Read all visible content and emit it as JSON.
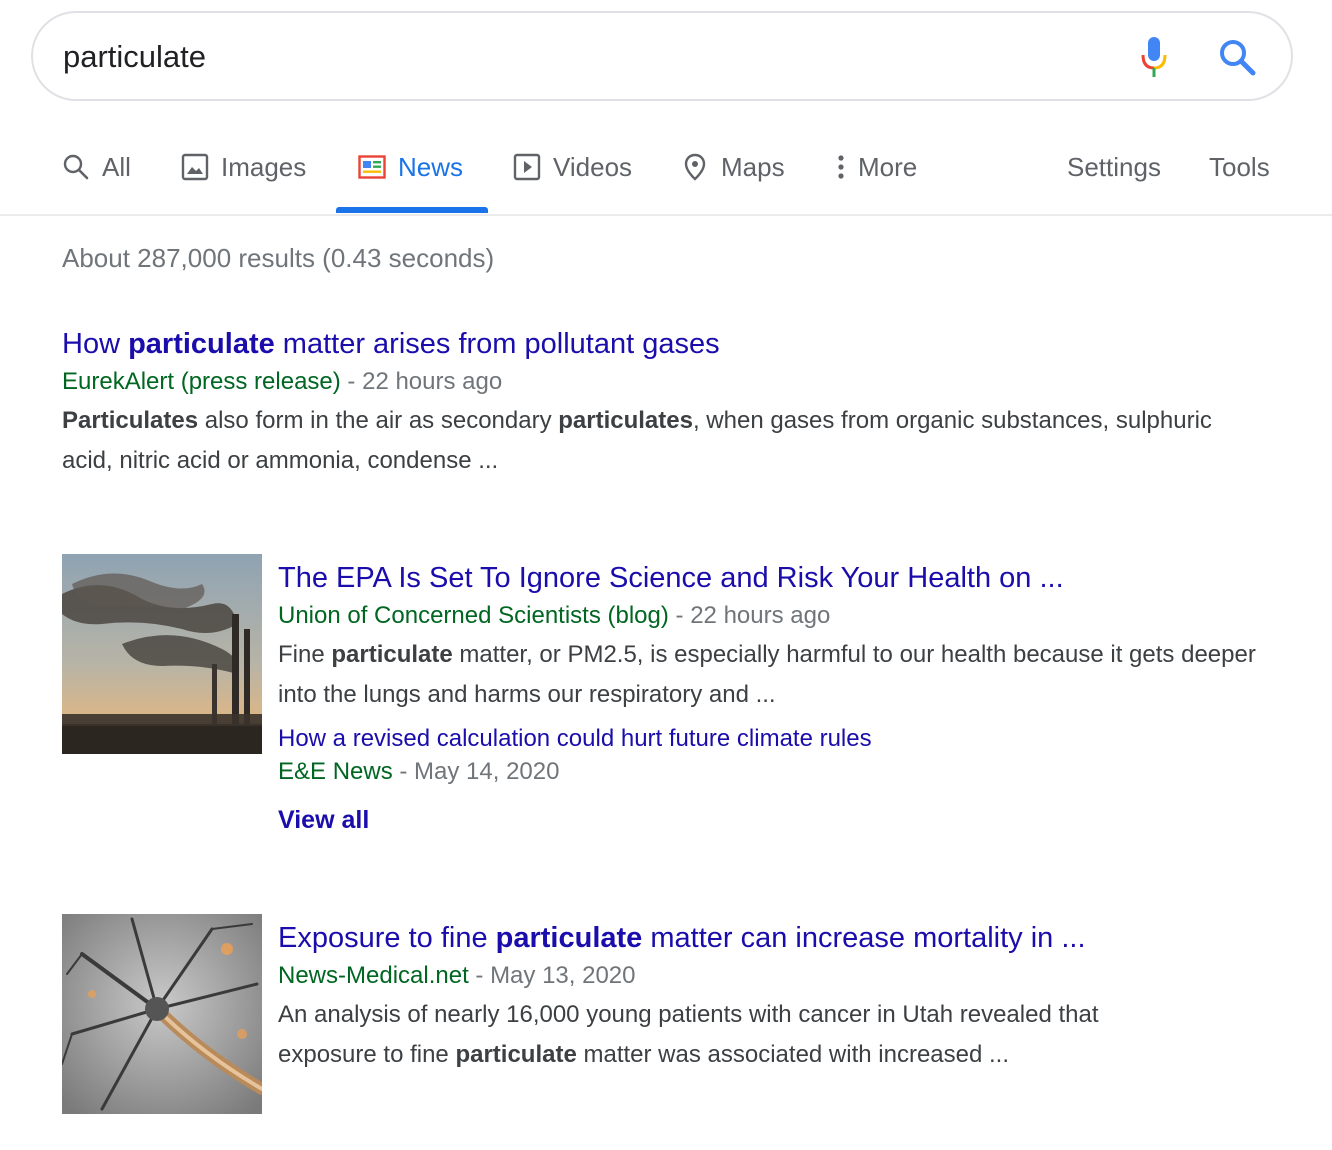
{
  "search": {
    "query": "particulate"
  },
  "tabs": [
    {
      "label": "All",
      "icon": "search-icon"
    },
    {
      "label": "Images",
      "icon": "image-icon"
    },
    {
      "label": "News",
      "icon": "news-icon",
      "active": true
    },
    {
      "label": "Videos",
      "icon": "play-icon"
    },
    {
      "label": "Maps",
      "icon": "map-pin-icon"
    },
    {
      "label": "More",
      "icon": "more-vertical-icon"
    },
    {
      "label": "Settings"
    },
    {
      "label": "Tools"
    }
  ],
  "stats": "About 287,000 results (0.43 seconds)",
  "results": [
    {
      "title_pre": "How ",
      "title_bold": "particulate",
      "title_post": " matter arises from pollutant gases",
      "source": "EurekAlert (press release)",
      "time": " - 22 hours ago",
      "snippet_b1": "Particulates",
      "snippet_t1": " also form in the air as secondary ",
      "snippet_b2": "particulates",
      "snippet_t2": ", when gases from organic substances, sulphuric acid, nitric acid or ammonia, condense ..."
    },
    {
      "title": "The EPA Is Set To Ignore Science and Risk Your Health on ...",
      "source": "Union of Concerned Scientists (blog)",
      "time": " - 22 hours ago",
      "snippet_t0": "Fine ",
      "snippet_b1": "particulate",
      "snippet_t1": " matter, or PM2.5, is especially harmful to our health because it gets deeper into the lungs and harms our respiratory and ...",
      "sub_title": "How a revised calculation could hurt future climate rules",
      "sub_source": "E&E News",
      "sub_time": " - May 14, 2020",
      "view_all": "View all",
      "thumb_icon": "smokestacks-image"
    },
    {
      "title_pre": "Exposure to fine ",
      "title_bold": "particulate",
      "title_post": " matter can increase mortality in ...",
      "source": "News-Medical.net",
      "time": " - May 13, 2020",
      "snippet_t0": "An analysis of nearly 16,000 young patients with cancer in Utah revealed that exposure to fine ",
      "snippet_b1": "particulate",
      "snippet_t1": " matter was associated with increased ...",
      "thumb_icon": "neurons-image"
    }
  ],
  "colors": {
    "link": "#1a0dab",
    "source_green": "#006621",
    "accent": "#1a73e8",
    "muted": "#70757a"
  }
}
